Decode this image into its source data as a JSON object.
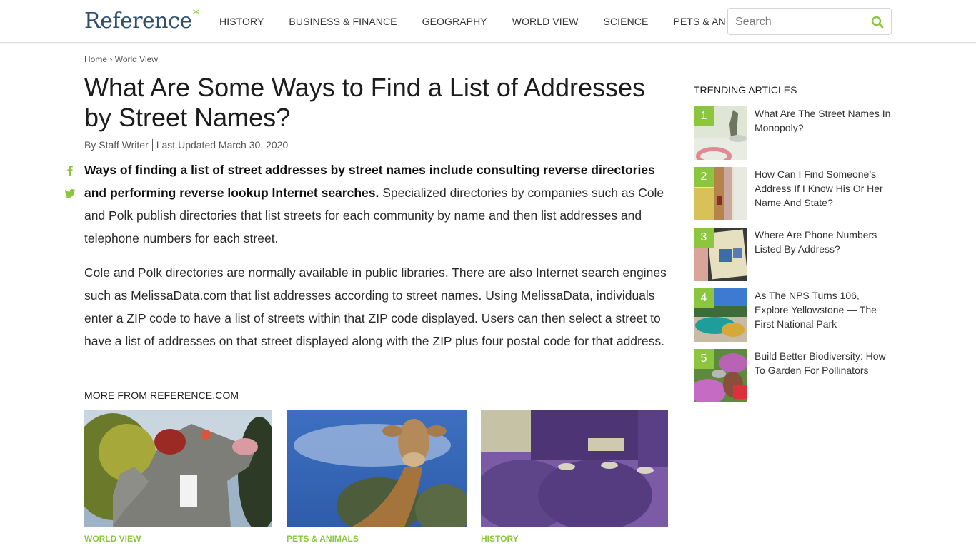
{
  "header": {
    "logo_text": "Reference",
    "logo_mark": "*",
    "nav": [
      "HISTORY",
      "BUSINESS & FINANCE",
      "GEOGRAPHY",
      "WORLD VIEW",
      "SCIENCE",
      "PETS & ANIMALS"
    ],
    "search_placeholder": "Search",
    "search_icon": "search-icon"
  },
  "breadcrumb": {
    "home": "Home",
    "separator": "›",
    "current": "World View"
  },
  "article": {
    "title": "What Are Some Ways to Find a List of Addresses by Street Names?",
    "author": "By Staff Writer",
    "updated": "Last Updated March 30, 2020",
    "share_icons": [
      "facebook-icon",
      "twitter-icon"
    ],
    "p1_bold": "Ways of finding a list of street addresses by street names include consulting reverse directories and performing reverse lookup Internet searches.",
    "p1_rest": " Specialized directories by companies such as Cole and Polk publish directories that list streets for each community by name and then list addresses and telephone numbers for each street.",
    "p2": "Cole and Polk directories are normally available in public libraries. There are also Internet search engines such as MelissaData.com that list addresses according to street names. Using MelissaData, individuals enter a ZIP code to have a list of streets within that ZIP code displayed. Users can then select a street to have a list of addresses on that street displayed along with the ZIP plus four postal code for that address."
  },
  "more": {
    "title": "MORE FROM REFERENCE.COM",
    "cards": [
      {
        "category": "WORLD VIEW",
        "image": "inflatable-rat-protest"
      },
      {
        "category": "PETS & ANIMALS",
        "image": "giraffe-sky"
      },
      {
        "category": "HISTORY",
        "image": "historic-crowd-purple"
      }
    ]
  },
  "trending": {
    "title": "TRENDING ARTICLES",
    "items": [
      {
        "num": "1",
        "title": "What Are The Street Names In Monopoly?"
      },
      {
        "num": "2",
        "title": "How Can I Find Someone’s Address If I Know His Or Her Name And State?"
      },
      {
        "num": "3",
        "title": "Where Are Phone Numbers Listed By Address?"
      },
      {
        "num": "4",
        "title": "As The NPS Turns 106, Explore Yellowstone — The First National Park"
      },
      {
        "num": "5",
        "title": "Build Better Biodiversity: How To Garden For Pollinators"
      }
    ]
  },
  "colors": {
    "accent": "#8cc63f",
    "logo": "#2f4f6b",
    "text": "#2b2b2b"
  }
}
